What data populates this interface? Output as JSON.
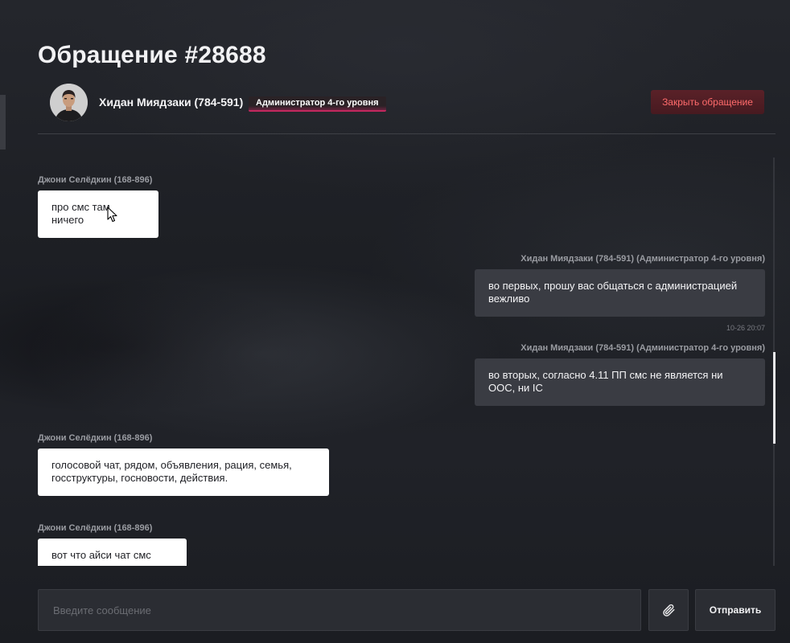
{
  "ticket": {
    "title": "Обращение #28688"
  },
  "admin": {
    "name": "Хидан Миядзаки (784-591)",
    "role": "Администратор 4-го уровня",
    "avatar_icon": "user-avatar-icon"
  },
  "actions": {
    "close_label": "Закрыть обращение",
    "close_color": "#ff6b6b"
  },
  "messages": [
    {
      "sender": "Джони Селёдкин (168-896)",
      "text": "про смс там ничего",
      "side": "left"
    },
    {
      "sender": "Хидан Миядзаки (784-591) (Администратор 4-го уровня)",
      "text": "во первых, прошу вас общаться с администрацией вежливо",
      "time": "10-26 20:07",
      "side": "right"
    },
    {
      "sender": "Хидан Миядзаки (784-591) (Администратор 4-го уровня)",
      "text": "во вторых, согласно 4.11 ПП смс не является ни ООС, ни IC",
      "side": "right"
    },
    {
      "sender": "Джони Селёдкин (168-896)",
      "text": "голосовой чат, рядом, объявления, рация, семья, госструктуры, госновости, действия.",
      "side": "left"
    },
    {
      "sender": "Джони Селёдкин (168-896)",
      "text": "вот что айси чат смс нету",
      "side": "left"
    }
  ],
  "composer": {
    "placeholder": "Введите сообщение",
    "value": "",
    "attach_icon": "paperclip-icon",
    "send_label": "Отправить"
  }
}
